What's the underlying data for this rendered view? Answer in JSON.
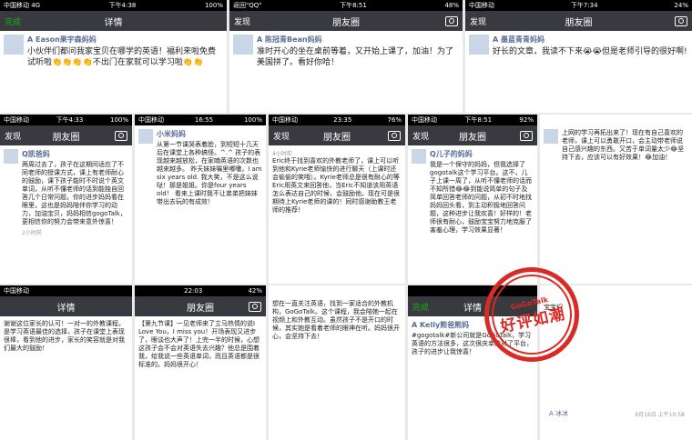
{
  "top_left": {
    "status": {
      "carrier": "中国移动 4G",
      "time": "下午4:38",
      "battery": "100%"
    },
    "nav": {
      "back": "完成",
      "title": "详情"
    },
    "post": {
      "name": "A Eason果宇森妈妈",
      "text": "小伙伴们都问我家宝贝在哪学的英语！福利来啦免费试听啦👏👏👏👏不出门在家就可以学习啦👏👏"
    }
  },
  "top_mid": {
    "status": {
      "carrier": "返回\"QQ\"",
      "time": "下午8:51",
      "battery": "48%"
    },
    "nav": {
      "back": "发现",
      "title": "朋友圈"
    },
    "post": {
      "name": "A 陈冠青Bean妈妈",
      "text": "准时开心的坐在桌前等着，又开始上课了，加油！为了美国拼了。看好你哈！"
    }
  },
  "top_right": {
    "status": {
      "carrier": "中国移动",
      "time": "下午7:34",
      "battery": "24%"
    },
    "nav": {
      "back": "发现",
      "title": "朋友圈"
    },
    "post": {
      "name": "A 墨蓝青青妈妈",
      "text": "好长的文章，我读不下来😭😭但是老师引导的很好啊!"
    }
  },
  "mid1": {
    "status": {
      "carrier": "中国移动",
      "time": "下午4:33",
      "battery": "100%"
    },
    "nav": {
      "back": "发现",
      "title": "朋友圈"
    },
    "post": {
      "name": "Q凯爸妈",
      "text": "两周过去了，孩子在这期间适应了不同老师的授课方式，课上有老师耐心的鼓励，课下孩子能时不时说个英文单词，从听不懂老师的话到能独自回答几个日常问题，你的进步妈妈看在眼里，这也是妈妈陪伴你学习的动力，加油宝贝，妈妈相信gogoTalk，更相信你的努力会带来意外惊喜！"
    },
    "time": "2小时前"
  },
  "mid2": {
    "status": {
      "carrier": "中国移动",
      "time": "16:55",
      "battery": "100%"
    },
    "nav": {
      "back": "",
      "title": ""
    },
    "post": {
      "name": "小米妈妈",
      "text": "从第一节课哭表着脸，到短短十几天后在课堂上各种搞怪。^.^ 孩子的表现越来越放松，在家喃英语的次数也越来越多。 昨天妹妹嘱里嘟囔，I am six years old. 我大笑，不是这么说哒！那是姐姐。你是four years old！ 看来上课时我不让弟弟把妹妹带出去玩的有成效！"
    }
  },
  "mid3": {
    "status": {
      "carrier": "中国移动",
      "time": "23:35",
      "battery": "76%"
    },
    "nav": {
      "back": "发现",
      "title": "朋友圈"
    },
    "post": {
      "name": "",
      "text": "Eric终于找到喜欢的外教老师了，课上可以听到他和Kyrie老师愉快的进行聊天（上课时还会偷偷的笑哦）。Kyrie老师总是很有耐心的等Eric用英文来回答他，当Eric不知道该用英语怎么表达自己的时候，会鼓励他。现在可是很期待上Kyrie老师的课的！同时感谢助教王老师的推荐！"
    },
    "time": "4小时前"
  },
  "mid4": {
    "status": {
      "carrier": "中国移动",
      "time": "下午8:51",
      "battery": "92%"
    },
    "nav": {
      "back": "发现",
      "title": "朋友圈"
    },
    "post": {
      "name": "Q儿子的妈妈",
      "text": "我是一个保守的妈妈，但我选择了gogotalk这个学习平台。这不，儿子上课一周了，从听不懂老师的话而不知所措😂😂到能说简单的句子及简单回答老师的问题，从初不时地找妈妈回头看，到主动积极地回答问题，这种进步让我欢喜！好样的！老师很有耐心，鼓励宝宝努力地克服了害羞心理，学习效果显著！"
    }
  },
  "mid5": {
    "status": {
      "carrier": "",
      "time": "",
      "battery": ""
    },
    "nav": {
      "back": "",
      "title": ""
    },
    "post": {
      "name": "",
      "text": "上网的学习再拓出来了！现在有自己喜欢的老师，课上可以勇敢开口，会主动带老师说自己感兴趣的东西。又苦于单词量太少😂坚持下去，应该可以有好效果！😂加油！"
    }
  },
  "bottom1": {
    "status": {
      "carrier": "中国移动",
      "time": "",
      "battery": ""
    },
    "nav": {
      "back": "",
      "title": "详情"
    },
    "post": {
      "name": "",
      "text": "谢谢这位家长的认可！一对一的外教课程，是学习英语最佳的选择，孩子在课堂上表现很棒，看到他的进步，家长的笑容就是对我们最大的鼓励！"
    }
  },
  "bottom2": {
    "status": {
      "carrier": "",
      "time": "22:03",
      "battery": "42%"
    },
    "nav": {
      "back": "",
      "title": "朋友圈"
    },
    "post": {
      "name": "",
      "text": "【第九节课】一见老师来了立马热情的说I Love You，I miss you！开场表现又进步了，眼谈也大声了！上完一半的时候，心想这孩子会不会对英语失去兴趣？他总是围着我，给我说一些英语单词，而且英语都是很标准的。妈妈很开心！"
    }
  },
  "bottom3": {
    "status": {
      "carrier": "",
      "time": "",
      "battery": ""
    },
    "nav": {
      "back": "",
      "title": ""
    },
    "post": {
      "name": "",
      "text": "想在一直关注英语，找到一家适合的外教机构，GoGoTalk。这个课程，我会陪她一起在视频上和外教互动。虽然孩子不是开口的时候，其实她是看着老师的眼神在听。妈妈很开心，会坚持下去！"
    }
  },
  "bottom4": {
    "status": {
      "carrier": "",
      "time": "",
      "battery": ""
    },
    "nav": {
      "back": "完成",
      "title": "详情"
    },
    "post": {
      "name": "A Kelly熊爸熊妈",
      "text": "#gogotalk#新公司就是GoGoTalk，学习英语的方法很多，这次很庆幸选对了平台，孩子的进步让我惊喜！"
    }
  },
  "bottom5": {
    "status": {
      "carrier": "",
      "time": "",
      "battery": ""
    },
    "nav": {
      "back": "",
      "title": ""
    },
    "post": {
      "name": "",
      "text": "宝宝们"
    },
    "comment_name": "A 冰冰",
    "comment_time": "6月16日 上午10:58"
  },
  "stamp": {
    "top": "GoGoTalk",
    "main": "好评如潮",
    "color": "#d92b25"
  }
}
